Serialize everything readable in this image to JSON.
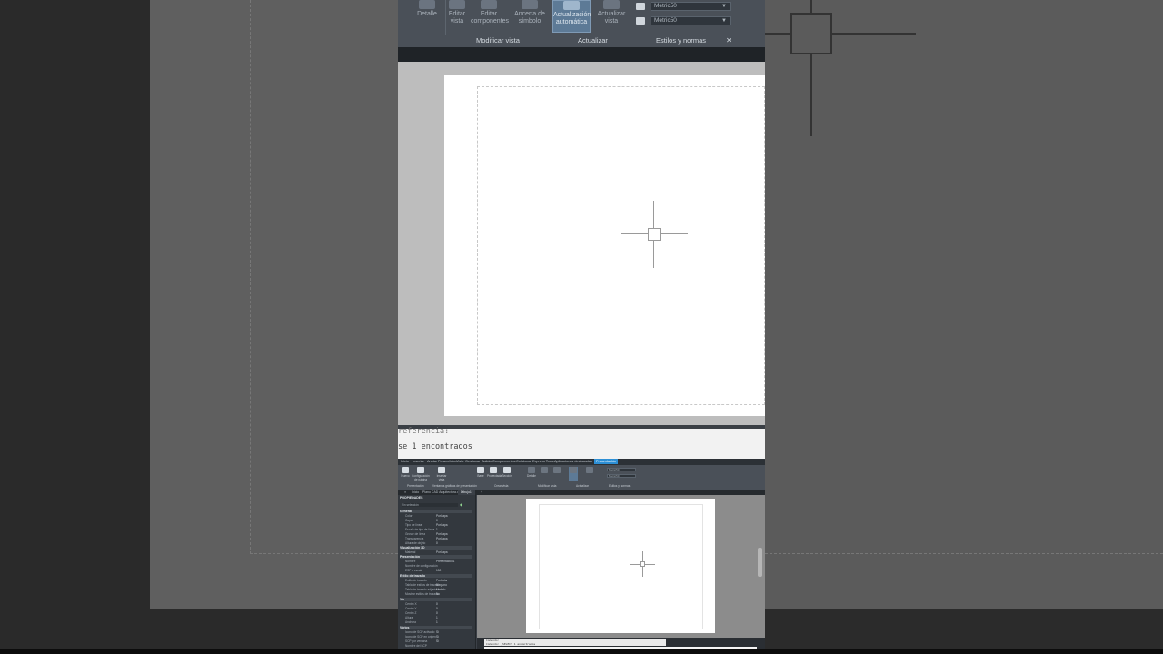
{
  "zoom_ribbon": {
    "buttons": [
      "Detalle",
      "Editar vista",
      "Editar componentes",
      "Ancerta de símbolo",
      "Actualización automática",
      "Actualizar vista"
    ],
    "active_button": "Actualización automática",
    "groups": [
      "Modificar vista",
      "Actualizar",
      "Estilos y normas"
    ],
    "style_dropdowns": [
      "Metric50",
      "Metric50"
    ]
  },
  "zoom_command": {
    "line1": "referencia:",
    "line2": "se 1 encontrados"
  },
  "app": {
    "menu": [
      "Inicio",
      "Insertar",
      "Anotar",
      "Paramétrico",
      "Vista",
      "Gestionar",
      "Salida",
      "Complementos",
      "Colaborar",
      "Express Tools",
      "Aplicaciones destacadas",
      "Presentación"
    ],
    "active_menu": "Presentación",
    "ribbon_buttons": [
      "Nuevo",
      "Configuración de página",
      "Insertar vista",
      "Base",
      "Proyectada",
      "Sección",
      "Detalle"
    ],
    "ribbon_groups": [
      "Presentación",
      "Ventanas gráficas de presentación",
      "Crear vista",
      "Modificar vista",
      "Actualizar",
      "Estilos y normas"
    ],
    "style_dropdowns": [
      "Metric50",
      "Metric50"
    ],
    "tabs": [
      "Inicio",
      "Plano CAD Arquitectura.dwg",
      "Dibujo1*"
    ],
    "active_tab": "Dibujo1*",
    "properties": {
      "title": "PROPIEDADES",
      "selector": "Sin selección",
      "sections": [
        {
          "name": "General",
          "rows": [
            [
              "Color",
              "PorCapa"
            ],
            [
              "Capa",
              "0"
            ],
            [
              "Tipo de línea",
              "PorCapa"
            ],
            [
              "Escala de tipo de línea",
              "1"
            ],
            [
              "Grosor de línea",
              "PorCapa"
            ],
            [
              "Transparencia",
              "PorCapa"
            ],
            [
              "Altura de objeto",
              "0"
            ]
          ]
        },
        {
          "name": "Visualización 3D",
          "rows": [
            [
              "Material",
              "PorCapa"
            ]
          ]
        },
        {
          "name": "Presentación",
          "rows": [
            [
              "Nombre",
              "Presentación1"
            ],
            [
              "Nombre de configuración",
              ""
            ],
            [
              "ESP a escala",
              "100"
            ]
          ]
        },
        {
          "name": "Estilo de trazado",
          "rows": [
            [
              "Estilo de trazado",
              "PorColor"
            ],
            [
              "Tabla de estilos de trazado",
              "Ninguno"
            ],
            [
              "Tabla de trazado adjunta a",
              "Modelo"
            ],
            [
              "Mostrar estilos de trazado",
              "No"
            ]
          ]
        },
        {
          "name": "Ver",
          "rows": [
            [
              "Centro X",
              "0"
            ],
            [
              "Centro Y",
              "0"
            ],
            [
              "Centro Z",
              "0"
            ],
            [
              "Altura",
              "1"
            ],
            [
              "Anchura",
              "1"
            ]
          ]
        },
        {
          "name": "Varios",
          "rows": [
            [
              "Icono de SCP activado",
              "Sí"
            ],
            [
              "Icono de SCP en origen",
              "Sí"
            ],
            [
              "SCP por ventana",
              "Sí"
            ],
            [
              "Nombre del SCP",
              ""
            ]
          ]
        }
      ]
    },
    "command": {
      "line1": "Comando:",
      "line2": "Comando: _SELECT 1 encontrados",
      "input_placeholder": "Escriba un comando"
    }
  }
}
